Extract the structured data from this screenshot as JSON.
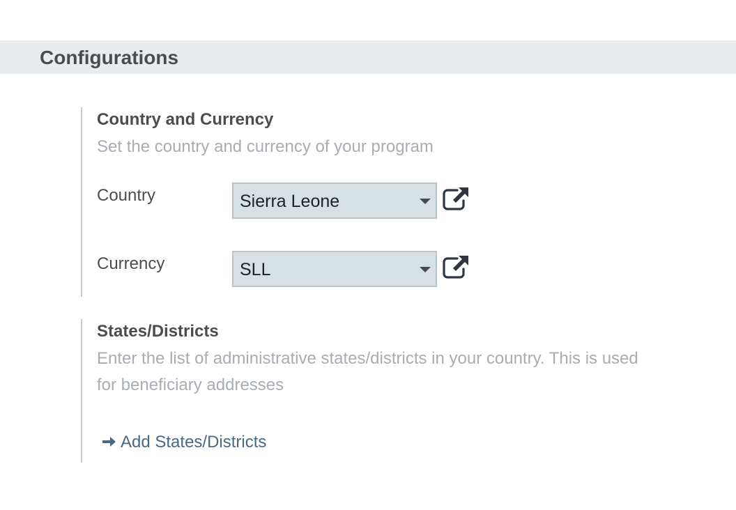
{
  "section": {
    "title": "Configurations"
  },
  "country_currency": {
    "title": "Country and Currency",
    "description": "Set the country and currency of your program",
    "country": {
      "label": "Country",
      "value": "Sierra Leone",
      "icon": "external-link-icon"
    },
    "currency": {
      "label": "Currency",
      "value": "SLL",
      "icon": "external-link-icon"
    }
  },
  "states_districts": {
    "title": "States/Districts",
    "description": "Enter the list of administrative states/districts in your country. This is used for beneficiary addresses",
    "action_label": "Add States/Districts",
    "action_icon": "arrow-right-icon"
  },
  "colors": {
    "header_background": "#e9ecef",
    "select_background": "#d6e0e5",
    "link": "#4a6a82",
    "muted_text": "#a8adb2"
  }
}
